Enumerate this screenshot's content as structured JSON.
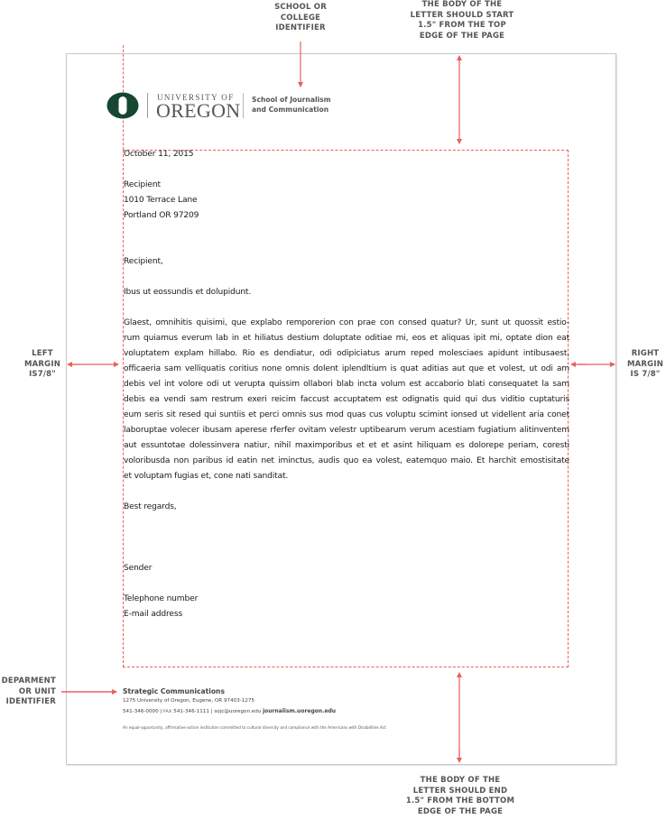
{
  "annotations": {
    "school_identifier": [
      "SCHOOL OR",
      "COLLEGE",
      "IDENTIFIER"
    ],
    "top_margin": [
      "THE BODY OF THE",
      "LETTER SHOULD START",
      "1.5\" FROM THE TOP",
      "EDGE OF THE PAGE"
    ],
    "left_margin": [
      "LEFT",
      "MARGIN",
      "IS7/8\""
    ],
    "right_margin": [
      "RIGHT",
      "MARGIN",
      "IS 7/8\""
    ],
    "department_identifier": [
      "DEPARMENT",
      "OR UNIT",
      "IDENTIFIER"
    ],
    "bottom_margin": [
      "THE BODY OF THE",
      "LETTER SHOULD END",
      "1.5\" FROM THE BOTTOM",
      "EDGE OF THE PAGE"
    ]
  },
  "colors": {
    "guide": "#e8605c",
    "oregon_green": "#154733",
    "annotation_text": "#555555",
    "page_border": "#c8c8c8"
  },
  "logo": {
    "university_small": "UNIVERSITY OF",
    "university_big": "OREGON",
    "school_line1": "School of Journalism",
    "school_line2": "and Communication"
  },
  "letter": {
    "date": "October 11, 2015",
    "recipient": [
      "Recipient",
      "1010 Terrace Lane",
      "Portland OR 97209"
    ],
    "salutation": "Recipient,",
    "intro": "Ibus ut eossundis et dolupidunt.",
    "body_lines": [
      "Glaest, omnihitis quisimi, que explabo remporerion con prae con consed quatur? Ur, sunt ut quossit estio-",
      "rum quiamus everum lab in et hiliatus destium doluptate oditiae mi, eos et aliquas ipit mi, optate dion eat",
      "voluptatem explam hillabo. Rio es dendiatur, odi odipiciatus arum reped molesciaes apidunt intibusaest,",
      "officaeria sam velliquatis coritius none omnis dolent iplendltium is quat aditias aut que et volest, ut odi am",
      "debis vel int volore odi ut verupta quissim ollabori blab incta volum est accaborio blati consequatet la sam",
      "debis ea vendi sam restrum exeri reicim faccust accuptatem est odignatis quid qui dus viditio cuptaturis",
      "eum seris sit resed qui suntiis et perci omnis sus mod quas cus voluptu scimint ionsed ut videllent aria conet",
      "laboruptae volecer ibusam aperese rferfer ovitam velestr uptibearum verum acestiam fugiatium alitinventem",
      "aut essuntotae dolessinvera natiur, nihil maximporibus et et et asint hiliquam es dolorepe periam, coresti",
      "voloribusda non paribus id eatin net iminctus, audis quo ea volest, eatemquo maio. Et harchit emostisitate",
      "et voluptam fugias et, cone nati sanditat."
    ],
    "closing": "Best regards,",
    "sender": "Sender",
    "telephone": "Telephone number",
    "email": "E-mail address"
  },
  "footer": {
    "department": "Strategic Communications",
    "address": "1275 University of Oregon, Eugene, OR 97403-1275",
    "phone": "541-346-0000 | ",
    "fax_label": "FAX",
    "fax": " 541-346-1111 | sojc@uoregon.edu  ",
    "website": "journalism.uoregon.edu",
    "eeo_statement": "An equal-opportunity, affirmative-action institution committed to cultural diversity and compliance with the Americans with Disabilities Act"
  }
}
